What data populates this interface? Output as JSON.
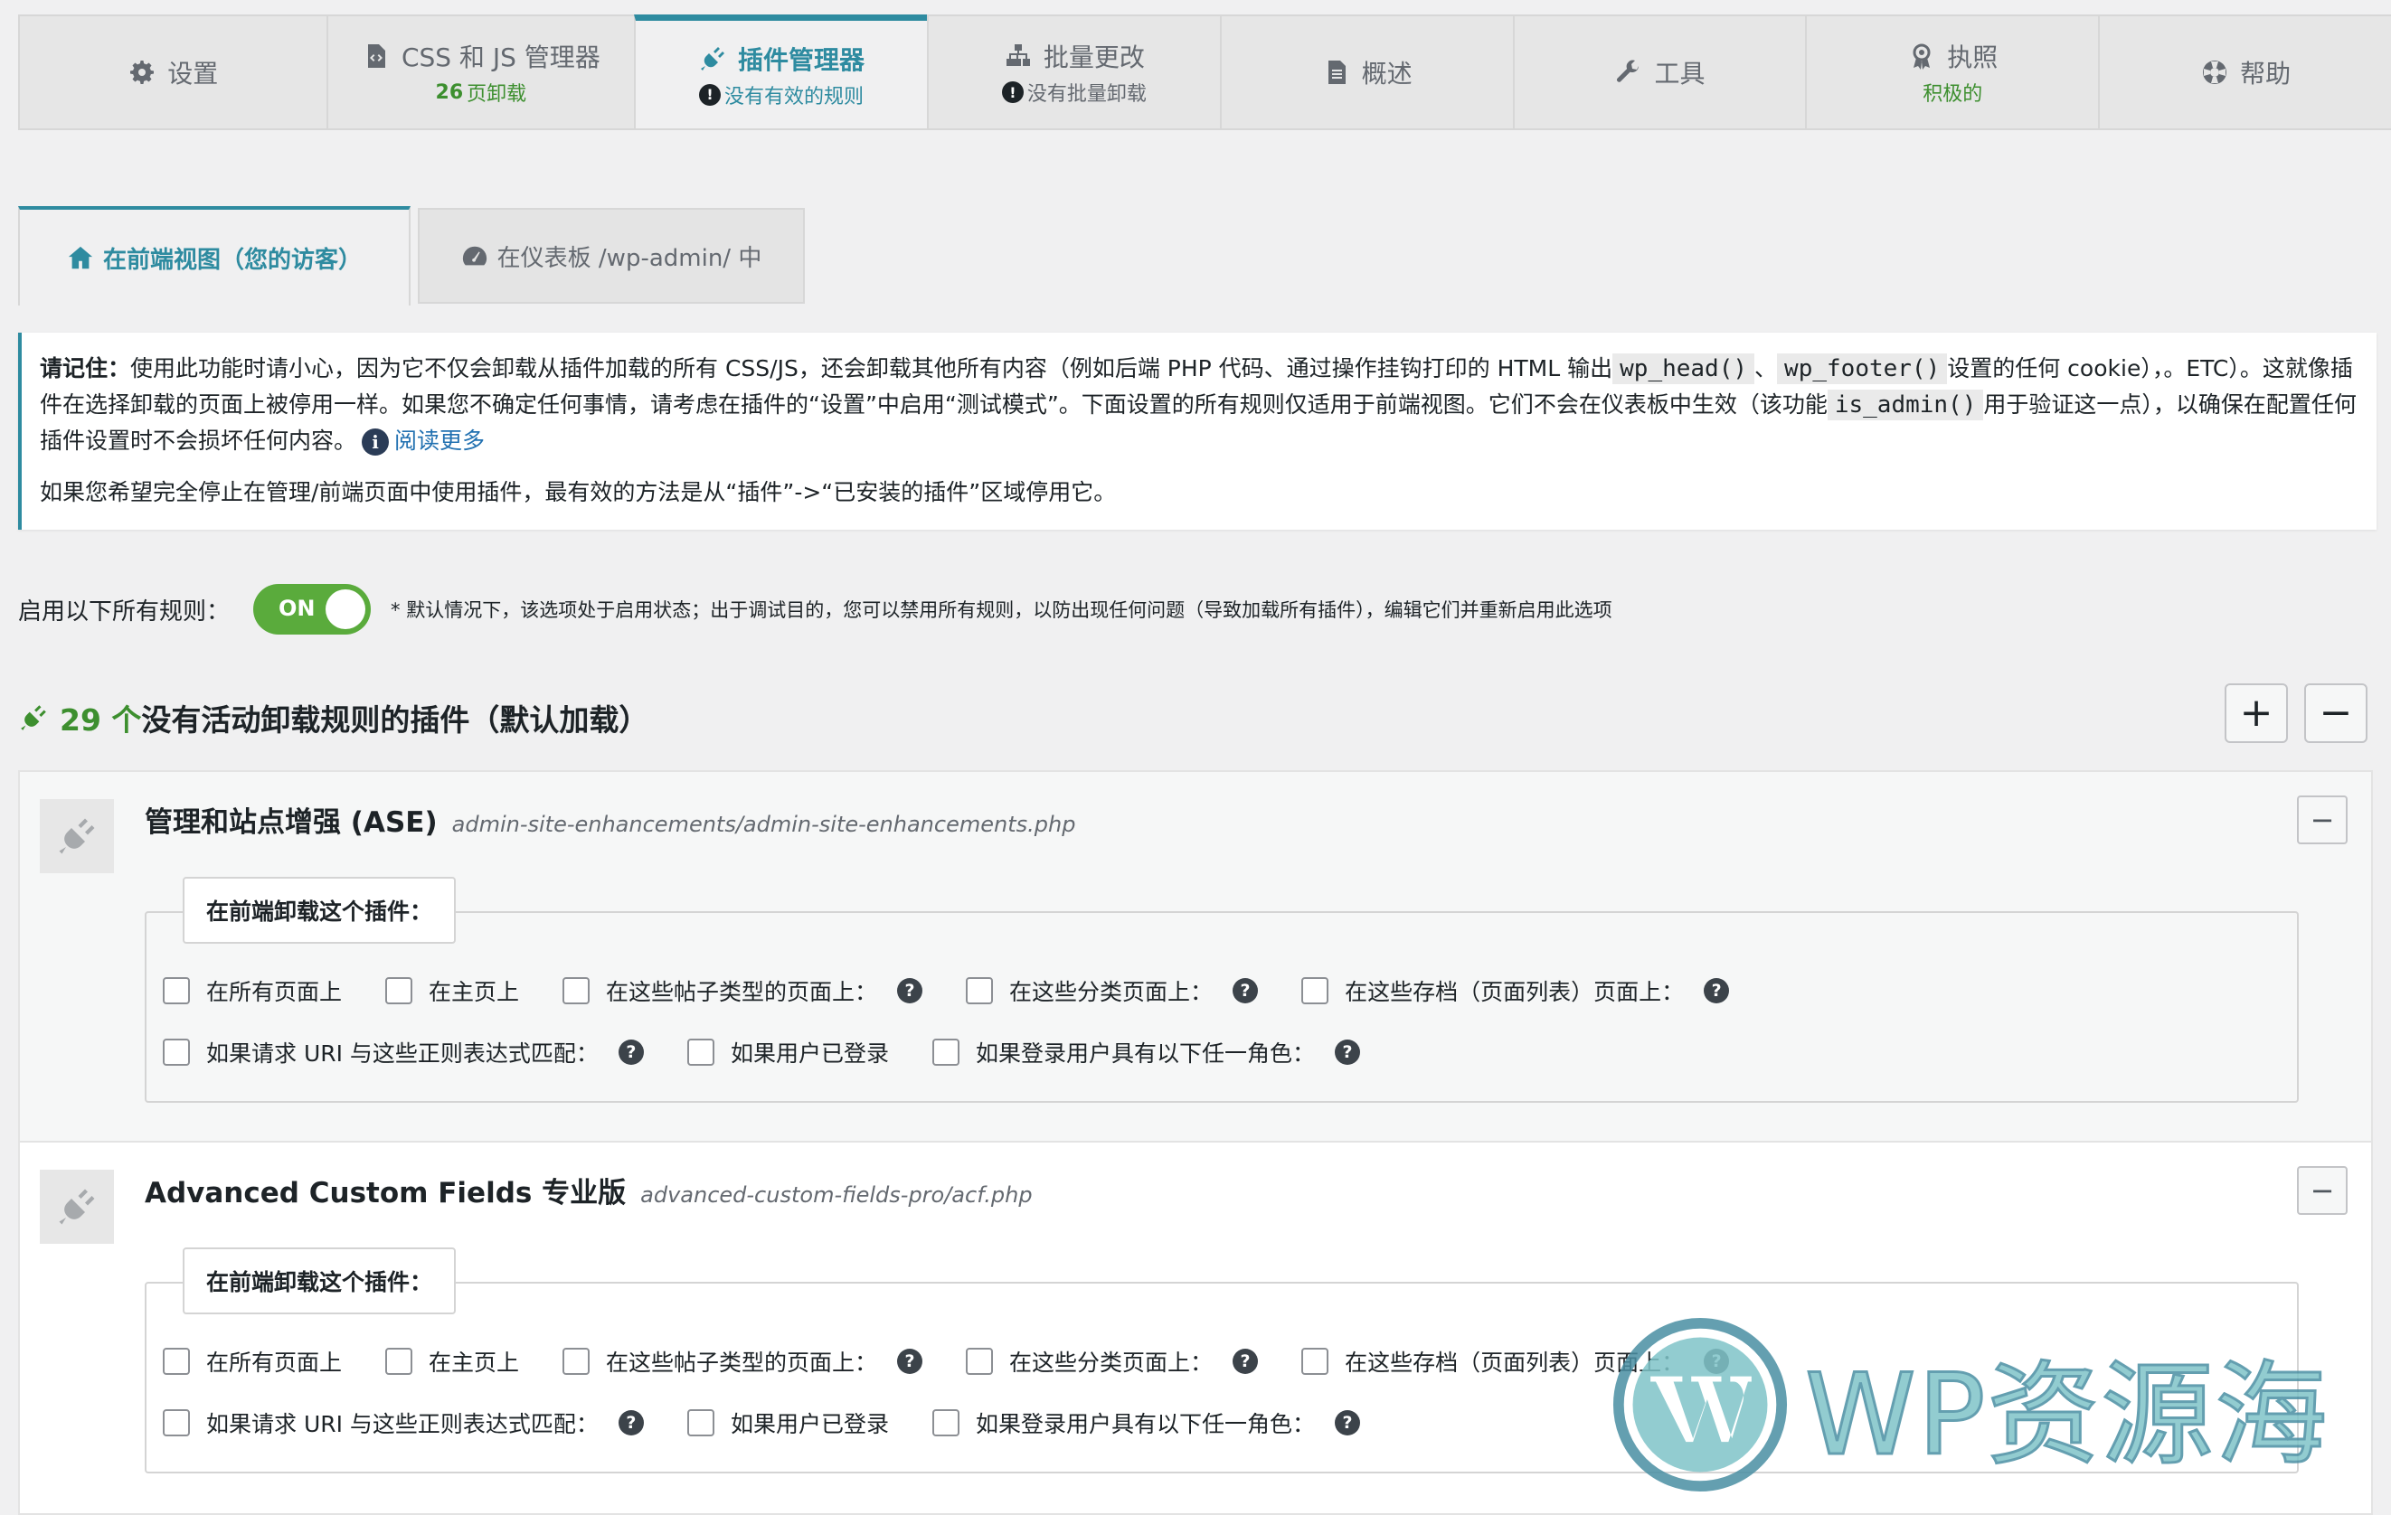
{
  "top_tabs": [
    {
      "label": "设置",
      "icon": "gear-icon"
    },
    {
      "label": "CSS 和 JS 管理器",
      "icon": "file-code-icon",
      "count": "26",
      "sub": "页卸载"
    },
    {
      "label": "插件管理器",
      "icon": "plug-icon",
      "sub": "没有有效的规则"
    },
    {
      "label": "批量更改",
      "icon": "sitemap-icon",
      "sub": "没有批量卸载"
    },
    {
      "label": "概述",
      "icon": "document-icon"
    },
    {
      "label": "工具",
      "icon": "wrench-icon"
    },
    {
      "label": "执照",
      "icon": "award-icon",
      "sub": "积极的"
    },
    {
      "label": "帮助",
      "icon": "lifebuoy-icon"
    }
  ],
  "sub_tabs": {
    "frontend": "在前端视图（您的访客）",
    "dashboard": "在仪表板 /wp-admin/ 中"
  },
  "notice": {
    "strong": "请记住：",
    "text1": "使用此功能时请小心，因为它不仅会卸载从插件加载的所有 CSS/JS，还会卸载其他所有内容（例如后端 PHP 代码、通过操作挂钩打印的 HTML 输出",
    "code1": "wp_head()",
    "sep1": "、",
    "code2": "wp_footer()",
    "text2": "设置的任何 cookie），。ETC）。这就像插件在选择卸载的页面上被停用一样。如果您不确定任何事情，请考虑在插件的“设置”中启用“测试模式”。下面设置的所有规则仅适用于前端视图。它们不会在仪表板中生效（该功能",
    "code3": "is_admin()",
    "text3": "用于验证这一点），以确保在配置任何插件设置时不会损坏任何内容。",
    "read_more": "阅读更多",
    "para2": "如果您希望完全停止在管理/前端页面中使用插件，最有效的方法是从“插件”->“已安装的插件”区域停用它。"
  },
  "toggle": {
    "label": "启用以下所有规则：",
    "state": "ON",
    "note": "* 默认情况下，该选项处于启用状态；出于调试目的，您可以禁用所有规则，以防出现任何问题（导致加载所有插件），编辑它们并重新启用此选项"
  },
  "section": {
    "count": "29 个",
    "title": "没有活动卸载规则的插件（默认加载）",
    "expand_label": "+",
    "collapse_label": "−"
  },
  "plugins": [
    {
      "name": "管理和站点增强 (ASE)",
      "path": "admin-site-enhancements/admin-site-enhancements.php",
      "legend": "在前端卸载这个插件：",
      "collapse": "−",
      "row1": [
        "在所有页面上",
        "在主页上",
        "在这些帖子类型的页面上：",
        "在这些分类页面上：",
        "在这些存档（页面列表）页面上："
      ],
      "row2": [
        "如果请求 URI 与这些正则表达式匹配：",
        "如果用户已登录",
        "如果登录用户具有以下任一角色："
      ]
    },
    {
      "name": "Advanced Custom Fields 专业版",
      "path": "advanced-custom-fields-pro/acf.php",
      "legend": "在前端卸载这个插件：",
      "collapse": "−",
      "row1": [
        "在所有页面上",
        "在主页上",
        "在这些帖子类型的页面上：",
        "在这些分类页面上：",
        "在这些存档（页面列表）页面上："
      ],
      "row2": [
        "如果请求 URI 与这些正则表达式匹配：",
        "如果用户已登录",
        "如果登录用户具有以下任一角色："
      ]
    }
  ],
  "help_glyph": "?",
  "info_glyph": "i",
  "alert_glyph": "!",
  "watermark": "WP资源海",
  "colors": {
    "accent": "#2e8ba0",
    "green": "#3d8f2f",
    "toggle_on": "#5aab3c",
    "link": "#2271b1"
  }
}
